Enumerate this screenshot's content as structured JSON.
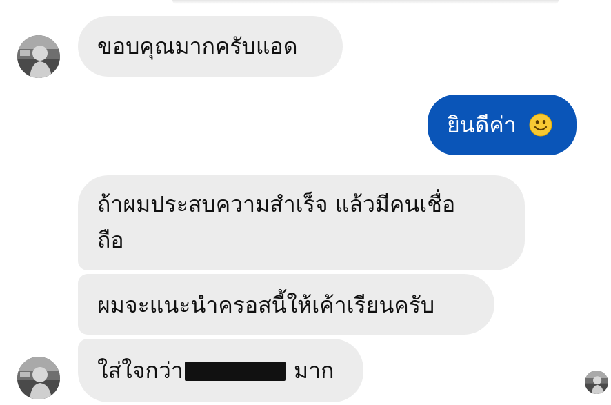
{
  "messages": [
    {
      "text": "ขอบคุณมากครับแอด",
      "side": "incoming"
    },
    {
      "text": "ยินดีค่า",
      "emoji": "smiley-emoji",
      "side": "outgoing"
    },
    {
      "line1": "ถ้าผมประสบความสำเร็จ แล้วมีคนเชื่อ",
      "line2": "ถือ",
      "side": "incoming"
    },
    {
      "text": "ผมจะแนะนำครอสนี้ให้เค้าเรียนครับ",
      "side": "incoming"
    },
    {
      "before": "ใส่ใจกว่า",
      "after": "มาก",
      "side": "incoming",
      "redacted": true
    }
  ],
  "colors": {
    "incoming_bubble": "#ececec",
    "outgoing_bubble": "#0a55b8",
    "text": "#111111"
  }
}
